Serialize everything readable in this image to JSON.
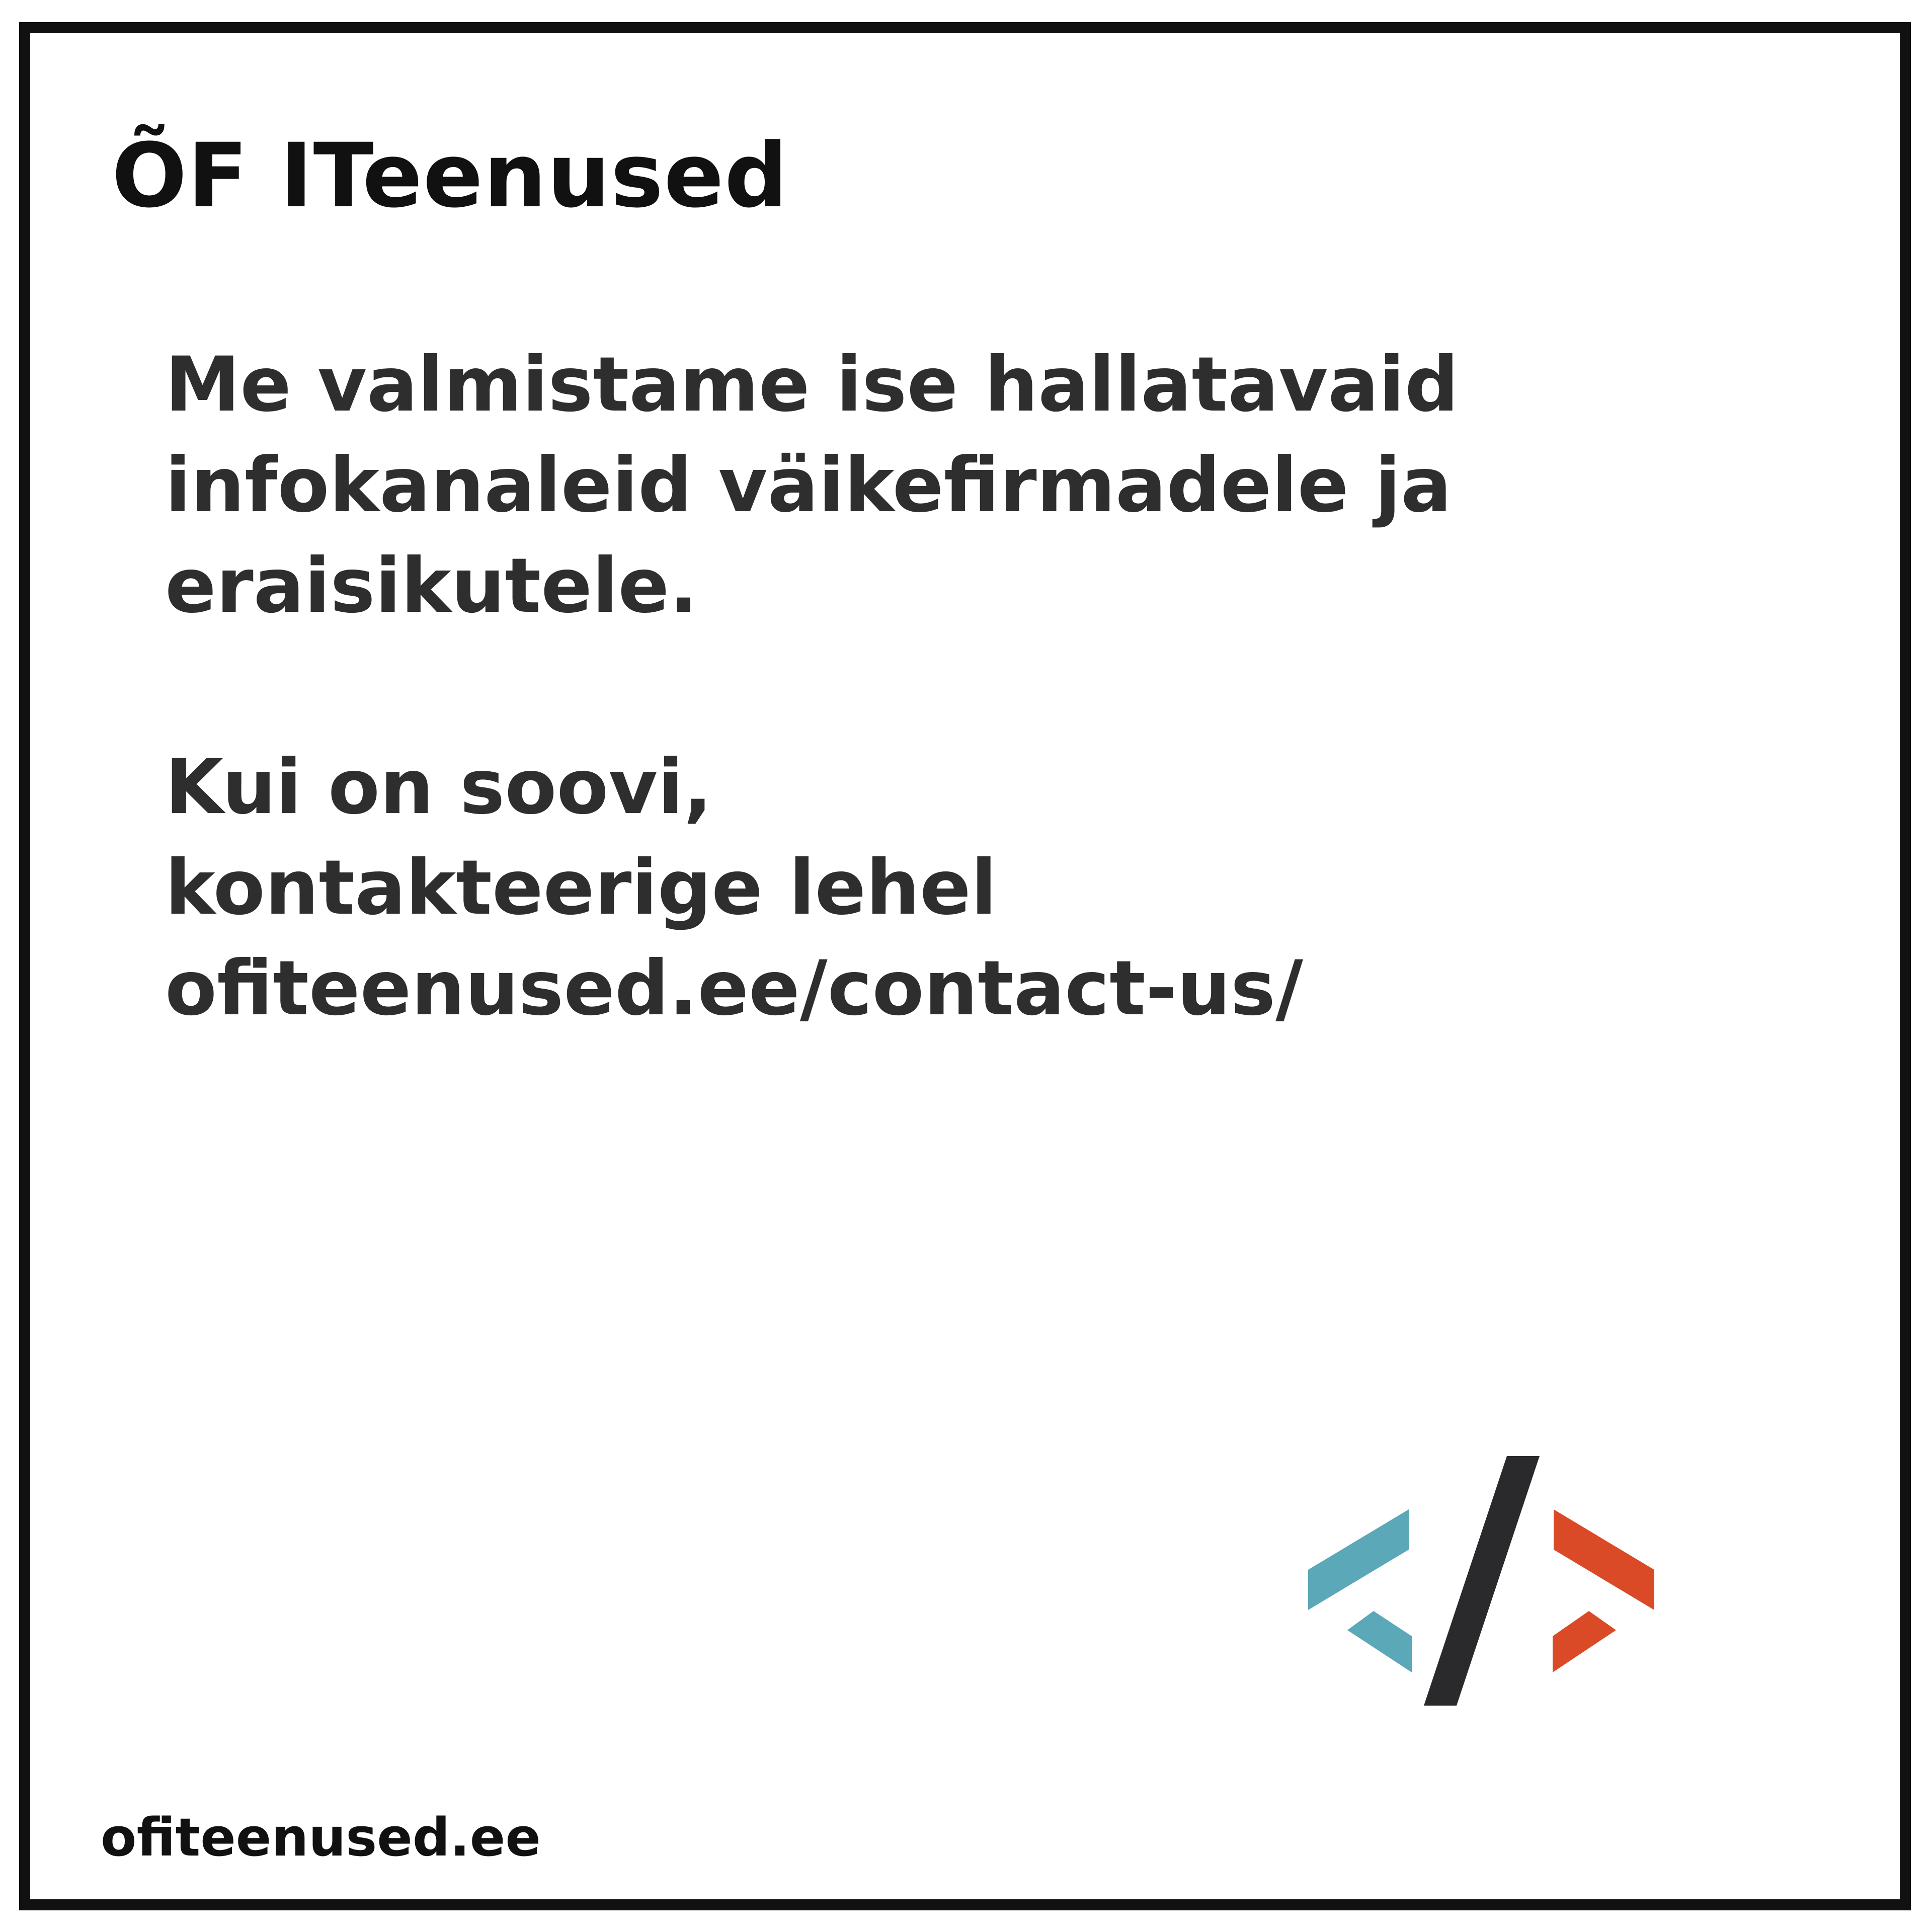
{
  "header": {
    "title": "ÕF ITeenused"
  },
  "message": {
    "paragraph1": [
      "Me valmistame ise hallatavaid",
      "infokanaleid väikefirmadele ja",
      "eraisikutele."
    ],
    "paragraph2": [
      "Kui on soovi,",
      "kontakteerige lehel",
      "ofiteenused.ee/contact-us/"
    ]
  },
  "logo": {
    "icon": "code-slash-icon",
    "colors": {
      "left_chevron": "#5ba8b8",
      "slash": "#2a2a2c",
      "right_chevron": "#db4a26"
    }
  },
  "footer": {
    "url": "ofiteenused.ee"
  },
  "colors": {
    "background": "#ffffff",
    "frame": "#111111",
    "text": "#2e2e2e"
  }
}
